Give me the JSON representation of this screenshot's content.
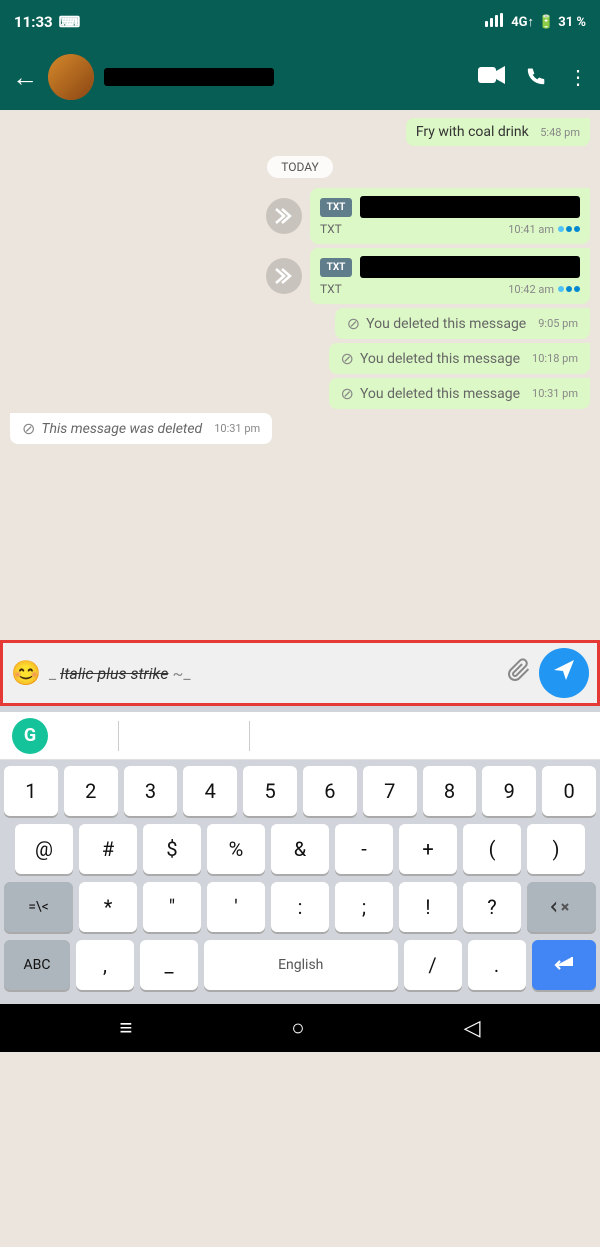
{
  "statusBar": {
    "time": "11:33",
    "signal": "4G↑",
    "battery": "31 %"
  },
  "header": {
    "back": "←",
    "name_hidden": true,
    "video_icon": "📹",
    "phone_icon": "📞",
    "more_icon": "⋮"
  },
  "chat": {
    "old_msg": "Fry with coal drink",
    "old_msg_time": "5:48 pm",
    "date_badge": "TODAY",
    "messages": [
      {
        "type": "file",
        "file_type": "TXT",
        "time": "10:41 am",
        "side": "right"
      },
      {
        "type": "file",
        "file_type": "TXT",
        "time": "10:42 am",
        "side": "right"
      },
      {
        "type": "deleted",
        "text": "You deleted this message",
        "time": "9:05 pm",
        "side": "right"
      },
      {
        "type": "deleted",
        "text": "You deleted this message",
        "time": "10:18 pm",
        "side": "right"
      },
      {
        "type": "deleted",
        "text": "You deleted this message",
        "time": "10:31 pm",
        "side": "right"
      },
      {
        "type": "deleted_received",
        "text": "This message was deleted",
        "time": "10:31 pm",
        "side": "left"
      }
    ]
  },
  "inputBar": {
    "emoji_icon": "😊",
    "input_prefix": "_",
    "input_italic_strike": "Italic plus strike",
    "input_suffix": "~_",
    "attach_icon": "📎",
    "send_icon": "➤"
  },
  "keyboard": {
    "grammarly_letter": "G",
    "row1": [
      "1",
      "2",
      "3",
      "4",
      "5",
      "6",
      "7",
      "8",
      "9",
      "0"
    ],
    "row2": [
      "@",
      "#",
      "$",
      "%",
      "&",
      "-",
      "+",
      "(",
      ")"
    ],
    "row3_special_left": "=\\<",
    "row3_middle": [
      "*",
      "\"",
      "'",
      ":",
      ";",
      "!",
      "?"
    ],
    "row4_abc": "ABC",
    "row4_comma": ",",
    "row4_underscore": "_",
    "row4_space": "English",
    "row4_slash": "/",
    "row4_dot": "."
  },
  "navBar": {
    "menu_icon": "≡",
    "home_icon": "○",
    "back_icon": "◁"
  }
}
